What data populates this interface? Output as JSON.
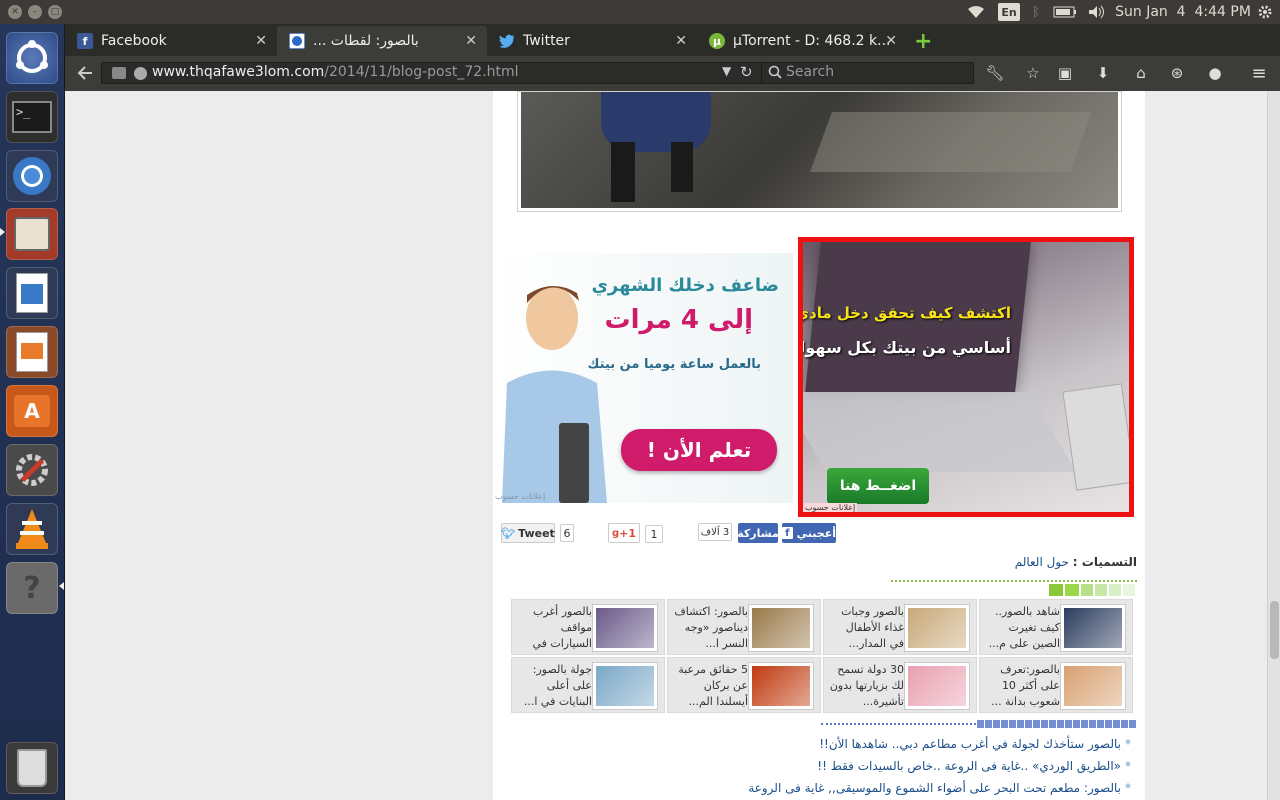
{
  "system": {
    "keyboard_layout": "En",
    "clock": "Sun Jan  4  4:44 PM"
  },
  "tabs": [
    {
      "label": "Facebook",
      "icon": "facebook-icon",
      "active": false
    },
    {
      "label": "بالصور: لقطات ...",
      "icon": "firefox-icon",
      "active": true
    },
    {
      "label": "Twitter",
      "icon": "twitter-icon",
      "active": false
    },
    {
      "label": "µTorrent - D: 468.2 k...",
      "icon": "utorrent-icon",
      "active": false
    }
  ],
  "address": {
    "domain": "www.thqafawe3lom.com",
    "path": "/2014/11/blog-post_72.html"
  },
  "search": {
    "placeholder": "Search"
  },
  "launcher": [
    "ubuntu-dash-icon",
    "terminal-icon",
    "chromium-icon",
    "file-manager-icon",
    "writer-icon",
    "impress-icon",
    "software-center-icon",
    "system-settings-icon",
    "vlc-icon",
    "help-icon",
    "trash-icon"
  ],
  "ads": {
    "left": {
      "headline": "ضاعف دخلك الشهري",
      "big": "إلى 4 مرات",
      "sub": "بالعمل ساعة يوميا من بيتك",
      "cta": "تعلم الأن !",
      "tag": "إعلانات حسوب"
    },
    "right": {
      "line1": "اكتشف كيف تحقق دخل مادي",
      "line2": "أساسي من بيتك بكل سهولة",
      "cta": "اضغــط هنا",
      "tag": "إعلانات حسوب"
    }
  },
  "social": {
    "tweet": "Tweet",
    "tweet_count": "6",
    "gplus": "+1",
    "gplus_count": "1",
    "fb_count": "3 آلاف",
    "share": "مشاركة",
    "like": "أعجبني"
  },
  "labels": {
    "title": "التسميات :",
    "value": "حول العالم"
  },
  "related": [
    {
      "text": "شاهد بالصور.. كيف تغيرت الصين على م...",
      "thumb": "#2b3c5e"
    },
    {
      "text": "بالصور وجبات غذاء الأطفال في المدار...",
      "thumb": "#c8a878"
    },
    {
      "text": "بالصور: اكتشاف ديناصور «وجه النسر ا...",
      "thumb": "#9a7a4a"
    },
    {
      "text": "بالصور أغرب مواقف السيارات في العال...",
      "thumb": "#6a5a8a"
    },
    {
      "text": "بالصور:تعرف على أكثر 10 شعوب بدانة ...",
      "thumb": "#d8a070"
    },
    {
      "text": "30 دولة تسمح لك بزيارتها بدون تأشيرة...",
      "thumb": "#e9a0b0"
    },
    {
      "text": "5 حقائق مرعبة عن بركان أيسلندا الم...",
      "thumb": "#c03a10"
    },
    {
      "text": "جولة بالصور: على أعلى البنايات في ا...",
      "thumb": "#7aa8c8"
    }
  ],
  "links": [
    "بالصور ستأخذك لجولة في أغرب مطاعم دبي.. شاهدها الأن!!",
    "«الطريق الوردي» ..غاية فى الروعة ..خاص بالسيدات فقط !!",
    "بالصور: مطعم تحت البحر على أضواء الشموع والموسيقى,, غاية فى الروعة"
  ]
}
